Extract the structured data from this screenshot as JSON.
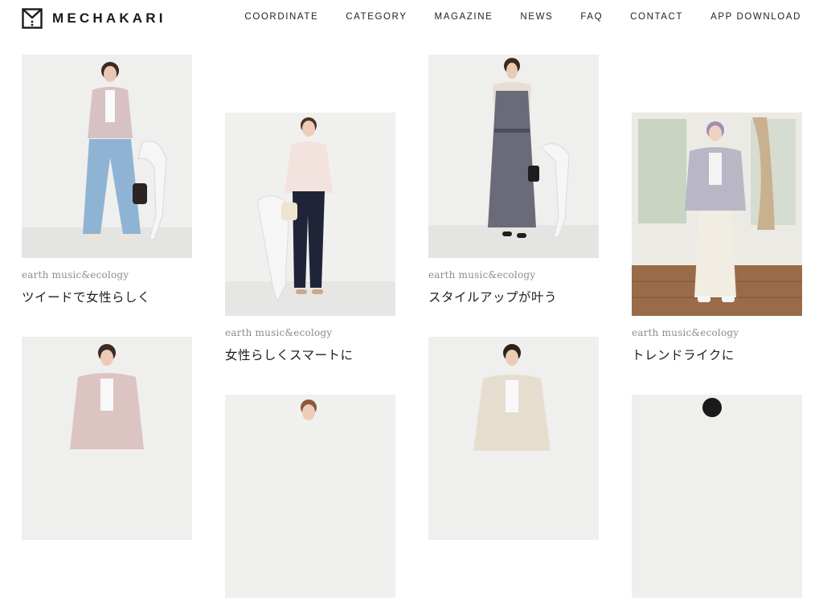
{
  "header": {
    "logo_text": "MECHAKARI",
    "nav": [
      "COORDINATE",
      "CATEGORY",
      "MAGAZINE",
      "NEWS",
      "FAQ",
      "CONTACT",
      "APP DOWNLOAD"
    ]
  },
  "cards": [
    {
      "brand": "earth music&ecology",
      "title": "ツイードで女性らしく"
    },
    {
      "brand": "earth music&ecology",
      "title": "女性らしくスマートに"
    },
    {
      "brand": "earth music&ecology",
      "title": "スタイルアップが叶う"
    },
    {
      "brand": "earth music&ecology",
      "title": "トレンドライクに"
    }
  ],
  "colors": {
    "text": "#1a1a1a",
    "brand_gray": "#8c8c8c",
    "photo_bg": "#eeeeec"
  }
}
